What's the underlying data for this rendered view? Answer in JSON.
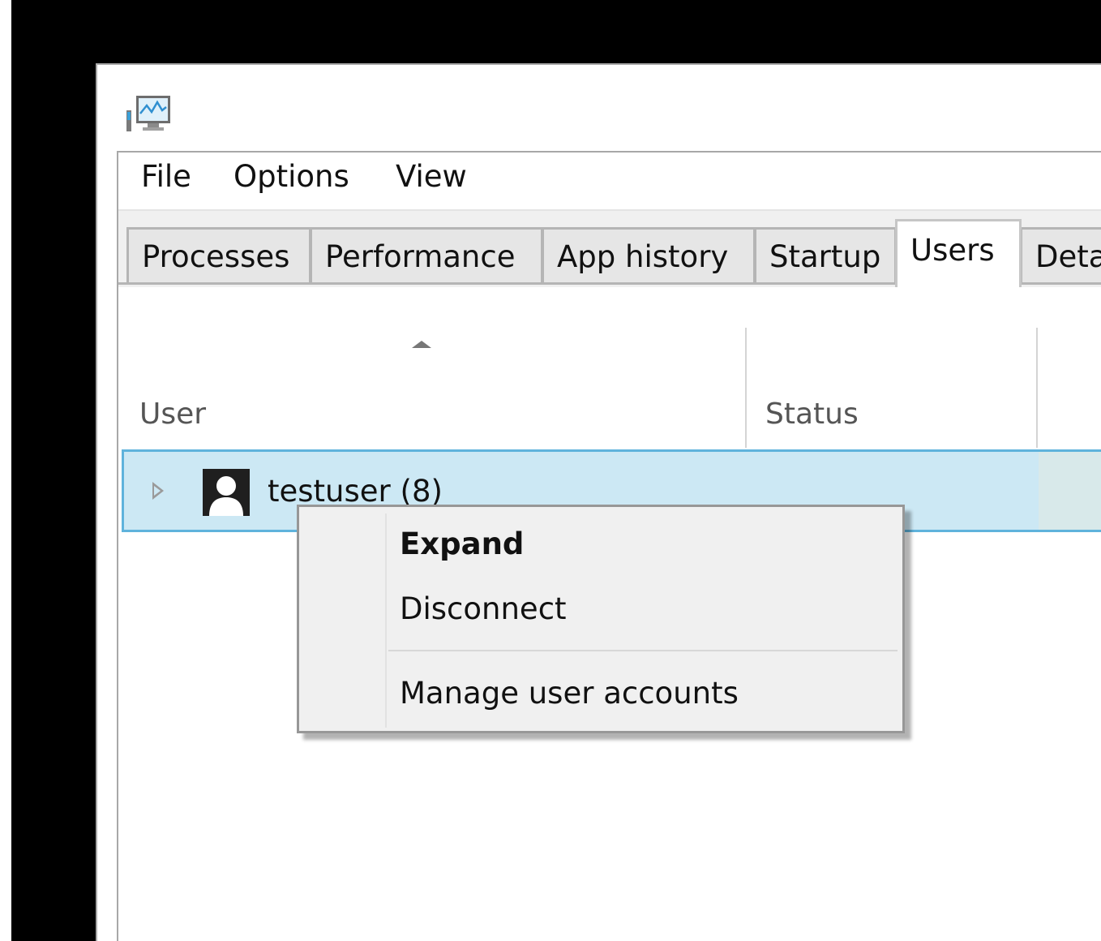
{
  "window": {
    "icon": "task-manager-monitor-icon"
  },
  "menubar": {
    "items": [
      "File",
      "Options",
      "View"
    ]
  },
  "tabs": [
    {
      "label": "Processes",
      "active": false
    },
    {
      "label": "Performance",
      "active": false
    },
    {
      "label": "App history",
      "active": false
    },
    {
      "label": "Startup",
      "active": false
    },
    {
      "label": "Users",
      "active": true
    },
    {
      "label": "Deta",
      "active": false
    }
  ],
  "columns": {
    "user": "User",
    "status": "Status",
    "sort_icon": "sort-ascending-icon"
  },
  "rows": [
    {
      "name": "testuser (8)",
      "icon": "user-avatar-icon",
      "expander_icon": "expand-triangle-icon",
      "selected": true
    }
  ],
  "context_menu": {
    "items": [
      {
        "label": "Expand",
        "bold": true
      },
      {
        "label": "Disconnect",
        "bold": false
      },
      {
        "label": "Manage user accounts",
        "bold": false
      }
    ]
  },
  "colors": {
    "selection_fill": "#cce8f4",
    "selection_border": "#5fb3dc",
    "menu_background": "#f0f0f0"
  }
}
